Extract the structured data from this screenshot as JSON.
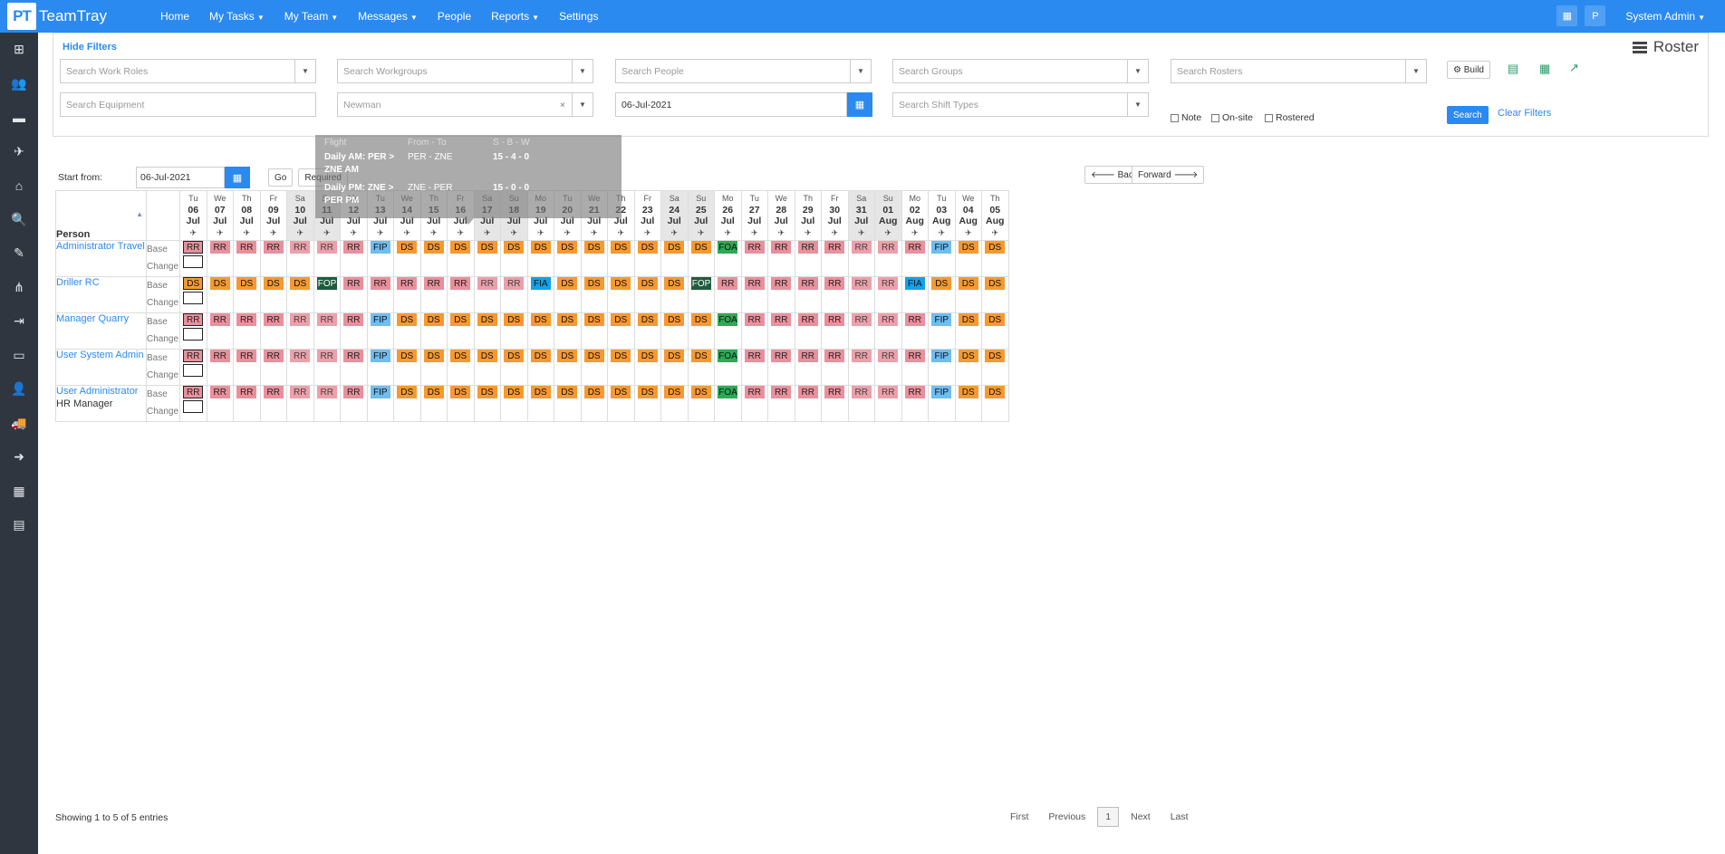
{
  "app": {
    "logo": "PT",
    "name": "TeamTray"
  },
  "nav": [
    {
      "label": "Home",
      "caret": false
    },
    {
      "label": "My Tasks",
      "caret": true
    },
    {
      "label": "My Team",
      "caret": true
    },
    {
      "label": "Messages",
      "caret": true
    },
    {
      "label": "People",
      "caret": false
    },
    {
      "label": "Reports",
      "caret": true
    },
    {
      "label": "Settings",
      "caret": false
    }
  ],
  "topright": {
    "apps_icon": "grid-icon",
    "avatar": "P",
    "user": "System Admin"
  },
  "sidebar_icons": [
    "dashboard-icon",
    "users-icon",
    "roster-icon",
    "plane-icon",
    "home-icon",
    "search-icon",
    "eraser-icon",
    "sitemap-icon",
    "sign-in-icon",
    "laptop-icon",
    "user-icon",
    "truck-icon",
    "arrow-right-icon",
    "calendar-icon",
    "book-icon"
  ],
  "filters": {
    "hide_label": "Hide Filters",
    "title": "Roster",
    "work_roles": "Search Work Roles",
    "workgroups": "Search Workgroups",
    "people": "Search People",
    "groups": "Search Groups",
    "rosters": "Search Rosters",
    "equipment": "Search Equipment",
    "newman": "Newman",
    "date": "06-Jul-2021",
    "shift_types": "Search Shift Types",
    "note": "Note",
    "onsite": "On-site",
    "rostered": "Rostered",
    "build": "Build",
    "search": "Search",
    "clear": "Clear Filters"
  },
  "toolbar": {
    "start_label": "Start from:",
    "start_date": "06-Jul-2021",
    "go": "Go",
    "required": "Required",
    "back": "Back",
    "forward": "Forward"
  },
  "tooltip": {
    "h_flight": "Flight",
    "h_from_to": "From - To",
    "h_sbw": "S - B - W",
    "r1_name": "Daily AM: PER >",
    "r1_name2": "ZNE AM",
    "r1_route": "PER - ZNE",
    "r1_sbw": "15 - 4 - 0",
    "r2_name": "Daily PM: ZNE >",
    "r2_name2": "PER PM",
    "r2_route": "ZNE - PER",
    "r2_sbw": "15 - 0 - 0"
  },
  "grid": {
    "person_header": "Person",
    "base_label": "Base",
    "change_label": "Change",
    "days": [
      {
        "d": "Tu",
        "n": "06",
        "m": "Jul",
        "we": false
      },
      {
        "d": "We",
        "n": "07",
        "m": "Jul",
        "we": false
      },
      {
        "d": "Th",
        "n": "08",
        "m": "Jul",
        "we": false
      },
      {
        "d": "Fr",
        "n": "09",
        "m": "Jul",
        "we": false
      },
      {
        "d": "Sa",
        "n": "10",
        "m": "Jul",
        "we": true
      },
      {
        "d": "Su",
        "n": "11",
        "m": "Jul",
        "we": true
      },
      {
        "d": "Mo",
        "n": "12",
        "m": "Jul",
        "we": false
      },
      {
        "d": "Tu",
        "n": "13",
        "m": "Jul",
        "we": false
      },
      {
        "d": "We",
        "n": "14",
        "m": "Jul",
        "we": false
      },
      {
        "d": "Th",
        "n": "15",
        "m": "Jul",
        "we": false
      },
      {
        "d": "Fr",
        "n": "16",
        "m": "Jul",
        "we": false
      },
      {
        "d": "Sa",
        "n": "17",
        "m": "Jul",
        "we": true
      },
      {
        "d": "Su",
        "n": "18",
        "m": "Jul",
        "we": true
      },
      {
        "d": "Mo",
        "n": "19",
        "m": "Jul",
        "we": false
      },
      {
        "d": "Tu",
        "n": "20",
        "m": "Jul",
        "we": false
      },
      {
        "d": "We",
        "n": "21",
        "m": "Jul",
        "we": false
      },
      {
        "d": "Th",
        "n": "22",
        "m": "Jul",
        "we": false
      },
      {
        "d": "Fr",
        "n": "23",
        "m": "Jul",
        "we": false
      },
      {
        "d": "Sa",
        "n": "24",
        "m": "Jul",
        "we": true
      },
      {
        "d": "Su",
        "n": "25",
        "m": "Jul",
        "we": true
      },
      {
        "d": "Mo",
        "n": "26",
        "m": "Jul",
        "we": false
      },
      {
        "d": "Tu",
        "n": "27",
        "m": "Jul",
        "we": false
      },
      {
        "d": "We",
        "n": "28",
        "m": "Jul",
        "we": false
      },
      {
        "d": "Th",
        "n": "29",
        "m": "Jul",
        "we": false
      },
      {
        "d": "Fr",
        "n": "30",
        "m": "Jul",
        "we": false
      },
      {
        "d": "Sa",
        "n": "31",
        "m": "Jul",
        "we": true
      },
      {
        "d": "Su",
        "n": "01",
        "m": "Aug",
        "we": true
      },
      {
        "d": "Mo",
        "n": "02",
        "m": "Aug",
        "we": false
      },
      {
        "d": "Tu",
        "n": "03",
        "m": "Aug",
        "we": false
      },
      {
        "d": "We",
        "n": "04",
        "m": "Aug",
        "we": false
      },
      {
        "d": "Th",
        "n": "05",
        "m": "Aug",
        "we": false
      }
    ],
    "people": [
      {
        "name": "Administrator Travel",
        "sub": "",
        "shifts": [
          "RR",
          "RR",
          "RR",
          "RR",
          "RR",
          "RR",
          "RR",
          "FIP",
          "DS",
          "DS",
          "DS",
          "DS",
          "DS",
          "DS",
          "DS",
          "DS",
          "DS",
          "DS",
          "DS",
          "DS",
          "FOA",
          "RR",
          "RR",
          "RR",
          "RR",
          "RR",
          "RR",
          "RR",
          "FIP",
          "DS",
          "DS"
        ]
      },
      {
        "name": "Driller RC",
        "sub": "",
        "shifts": [
          "DS",
          "DS",
          "DS",
          "DS",
          "DS",
          "FOP",
          "RR",
          "RR",
          "RR",
          "RR",
          "RR",
          "RR",
          "RR",
          "FIA",
          "DS",
          "DS",
          "DS",
          "DS",
          "DS",
          "FOP",
          "RR",
          "RR",
          "RR",
          "RR",
          "RR",
          "RR",
          "RR",
          "FIA",
          "DS",
          "DS",
          "DS"
        ]
      },
      {
        "name": "Manager Quarry",
        "sub": "",
        "shifts": [
          "RR",
          "RR",
          "RR",
          "RR",
          "RR",
          "RR",
          "RR",
          "FIP",
          "DS",
          "DS",
          "DS",
          "DS",
          "DS",
          "DS",
          "DS",
          "DS",
          "DS",
          "DS",
          "DS",
          "DS",
          "FOA",
          "RR",
          "RR",
          "RR",
          "RR",
          "RR",
          "RR",
          "RR",
          "FIP",
          "DS",
          "DS"
        ]
      },
      {
        "name": "User System Admin",
        "sub": "",
        "shifts": [
          "RR",
          "RR",
          "RR",
          "RR",
          "RR",
          "RR",
          "RR",
          "FIP",
          "DS",
          "DS",
          "DS",
          "DS",
          "DS",
          "DS",
          "DS",
          "DS",
          "DS",
          "DS",
          "DS",
          "DS",
          "FOA",
          "RR",
          "RR",
          "RR",
          "RR",
          "RR",
          "RR",
          "RR",
          "FIP",
          "DS",
          "DS"
        ]
      },
      {
        "name": "User Administrator",
        "sub": "HR Manager",
        "shifts": [
          "RR",
          "RR",
          "RR",
          "RR",
          "RR",
          "RR",
          "RR",
          "FIP",
          "DS",
          "DS",
          "DS",
          "DS",
          "DS",
          "DS",
          "DS",
          "DS",
          "DS",
          "DS",
          "DS",
          "DS",
          "FOA",
          "RR",
          "RR",
          "RR",
          "RR",
          "RR",
          "RR",
          "RR",
          "FIP",
          "DS",
          "DS"
        ]
      }
    ]
  },
  "footer": {
    "info": "Showing 1 to 5 of 5 entries",
    "first": "First",
    "previous": "Previous",
    "page": "1",
    "next": "Next",
    "last": "Last"
  }
}
